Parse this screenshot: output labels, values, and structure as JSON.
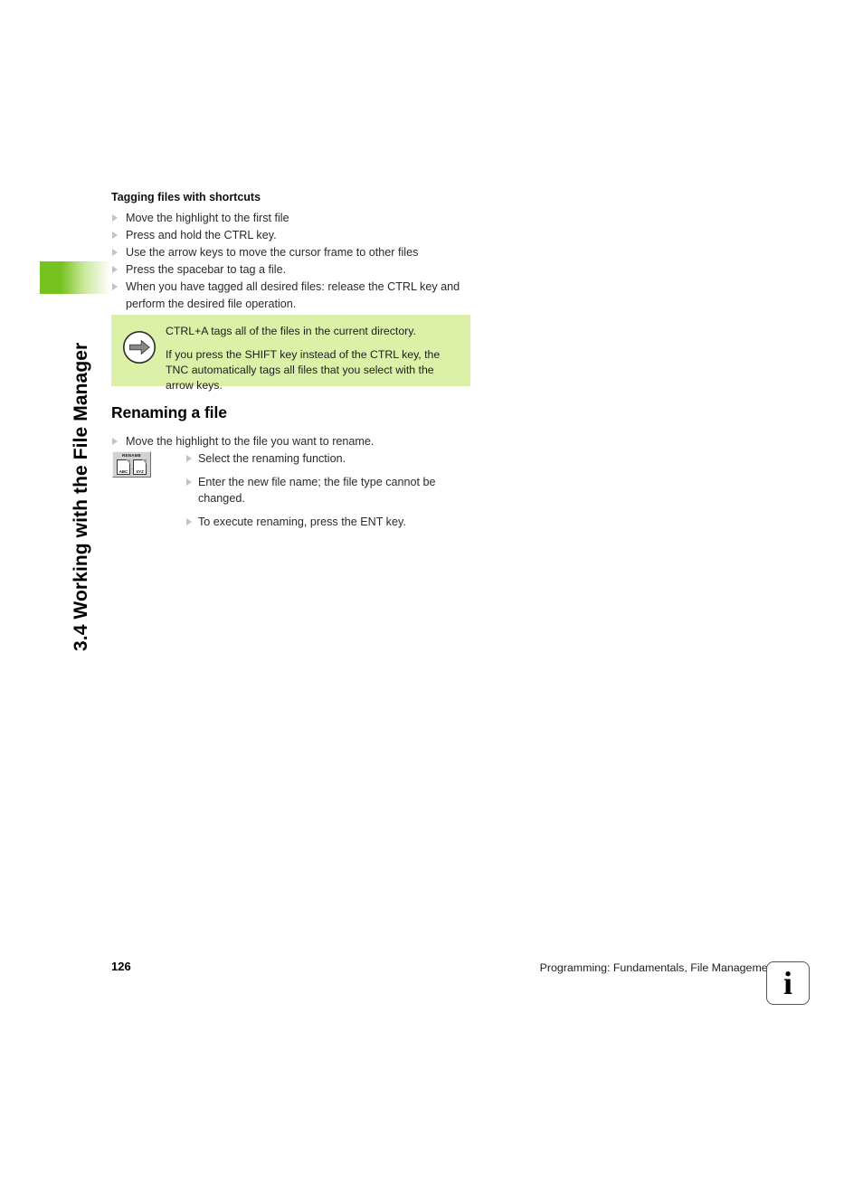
{
  "sidebar": {
    "chapter_title": "3.4 Working with the File Manager",
    "tab_color": "#76c21f"
  },
  "content": {
    "tagging": {
      "heading": "Tagging files with shortcuts",
      "items": [
        "Move the highlight to the first file",
        "Press and hold the CTRL key.",
        "Use the arrow keys to move the cursor frame to other files",
        "Press the spacebar to tag a file.",
        "When you have tagged all desired files: release the CTRL key and perform the desired file operation."
      ]
    },
    "note": {
      "icon": "arrow-right-circle-icon",
      "background_color": "#dcf0a8",
      "paragraphs": [
        "CTRL+A tags all of the files in the current directory.",
        "If you press the SHIFT key instead of the CTRL key, the TNC automatically tags all files that you select with the arrow keys."
      ]
    },
    "renaming": {
      "heading": "Renaming a file",
      "lead_item": "Move the highlight to the file you want to rename.",
      "softkey": {
        "caption": "RENAME",
        "doc_left_label": "ABC",
        "doc_right_label": "XYZ",
        "separator": "→"
      },
      "items": [
        "Select the renaming function.",
        "Enter the new file name; the file type cannot be changed.",
        "To execute renaming, press the ENT key."
      ]
    }
  },
  "footer": {
    "page_number": "126",
    "section_text": "Programming: Fundamentals, File Management",
    "info_glyph": "i"
  }
}
